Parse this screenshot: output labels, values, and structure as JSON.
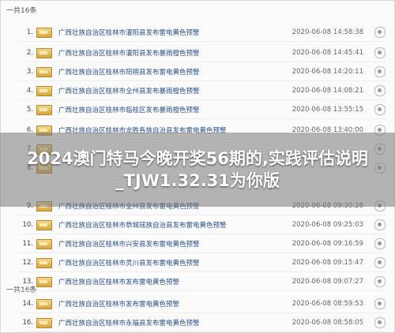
{
  "total_label_1": "一共16条",
  "total_label_2": "一共16条",
  "items": [
    {
      "num": "1.",
      "title": "广西壮族自治区桂林市灌阳县发布雷电黄色预警",
      "date": "2020-06-08 14:58:38"
    },
    {
      "num": "2.",
      "title": "广西壮族自治区桂林市灌阳县发布暴雨橙色预警",
      "date": "2020-06-08 14:45:41"
    },
    {
      "num": "3.",
      "title": "广西壮族自治区桂林市阳朔县发布雷电黄色预警",
      "date": "2020-06-08 14:20:11"
    },
    {
      "num": "4.",
      "title": "广西壮族自治区桂林市全州县发布暴雨橙色预警",
      "date": "2020-06-08 14:08:21"
    },
    {
      "num": "5.",
      "title": "广西壮族自治区桂林市临桂区发布暴雨橙色预警",
      "date": "2020-06-08 13:55:15"
    },
    {
      "num": "6.",
      "title": "广西壮族自治区桂林市龙胜各族自治县发布雷电黄色预警",
      "date": "2020-06-08 13:40:00"
    },
    {
      "num": "7.",
      "title": "",
      "date": ""
    },
    {
      "num": "8.",
      "title": "",
      "date": ""
    },
    {
      "num": "9.",
      "title": "广西壮族自治区桂林市全州县发布雷电黄色预警",
      "date": "2020-06-08 09:30:26"
    },
    {
      "num": "10.",
      "title": "广西壮族自治区桂林市恭城瑶族自治县发布雷电黄色预警",
      "date": "2020-06-08 09:25:03"
    },
    {
      "num": "11.",
      "title": "广西壮族自治区桂林市兴安县发布雷电黄色预警",
      "date": "2020-06-08 09:16:59"
    },
    {
      "num": "12.",
      "title": "广西壮族自治区桂林市灵川县发布雷电黄色预警",
      "date": "2020-06-08 09:15:47"
    },
    {
      "num": "13.",
      "title": "广西壮族自治区桂林市发布雷电黄色预警",
      "date": "2020-06-08 09:07:27"
    },
    {
      "num": "14.",
      "title": "广西壮族自治区桂林市发布雷电黄色预警",
      "date": "2020-06-08 08:59:53"
    },
    {
      "num": "16.",
      "title": "广西壮族自治区桂林市永福县发布雷电黄色预警",
      "date": "2020-06-08 08:58:05"
    }
  ],
  "banner": "2024澳门特马今晚开奖56期的,实践评估说明_TJW1.32.31为你版"
}
